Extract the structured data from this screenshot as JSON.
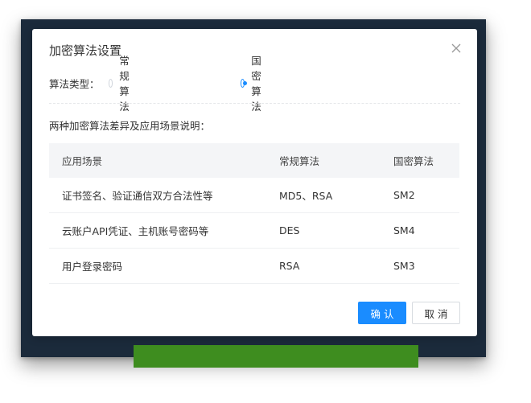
{
  "dialog": {
    "title": "加密算法设置",
    "close_icon": "close-icon"
  },
  "algorithm": {
    "label": "算法类型：",
    "options": [
      {
        "label": "常规算法",
        "checked": false
      },
      {
        "label": "国密算法",
        "checked": true
      }
    ]
  },
  "description": "两种加密算法差异及应用场景说明：",
  "table": {
    "headers": [
      "应用场景",
      "常规算法",
      "国密算法"
    ],
    "rows": [
      [
        "证书签名、验证通信双方合法性等",
        "MD5、RSA",
        "SM2"
      ],
      [
        "云账户API凭证、主机账号密码等",
        "DES",
        "SM4"
      ],
      [
        "用户登录密码",
        "RSA",
        "SM3"
      ]
    ]
  },
  "buttons": {
    "confirm": "确认",
    "cancel": "取消"
  },
  "colors": {
    "accent": "#1a8cff",
    "backdrop": "#1b2a3b",
    "background_button": "#3e8d1f"
  }
}
